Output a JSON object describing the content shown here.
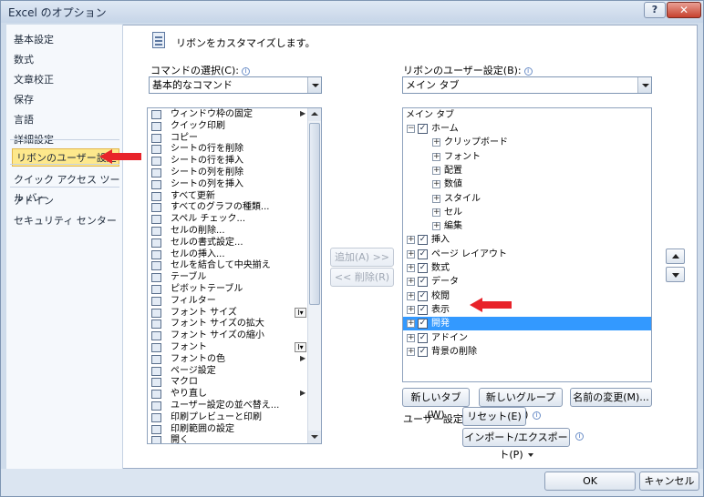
{
  "window": {
    "title": "Excel のオプション",
    "help_label": "?",
    "close_label": "✕"
  },
  "nav": {
    "items": [
      {
        "label": "基本設定"
      },
      {
        "label": "数式"
      },
      {
        "label": "文章校正"
      },
      {
        "label": "保存"
      },
      {
        "label": "言語"
      },
      {
        "label": "詳細設定"
      },
      {
        "label": "リボンのユーザー設定",
        "selected": true
      },
      {
        "label": "クイック アクセス ツール バー"
      },
      {
        "label": "アドイン"
      },
      {
        "label": "セキュリティ センター"
      }
    ]
  },
  "main": {
    "intro": "リボンをカスタマイズします。",
    "commands_label": "コマンドの選択(C):",
    "commands_value": "基本的なコマンド",
    "ribbon_label": "リボンのユーザー設定(B):",
    "ribbon_value": "メイン タブ",
    "commands": [
      {
        "label": "ウィンドウ枠の固定",
        "mark": "▶"
      },
      {
        "label": "クイック印刷"
      },
      {
        "label": "コピー"
      },
      {
        "label": "シートの行を削除"
      },
      {
        "label": "シートの行を挿入"
      },
      {
        "label": "シートの列を削除"
      },
      {
        "label": "シートの列を挿入"
      },
      {
        "label": "すべて更新"
      },
      {
        "label": "すべてのグラフの種類..."
      },
      {
        "label": "スペル チェック..."
      },
      {
        "label": "セルの削除..."
      },
      {
        "label": "セルの書式設定..."
      },
      {
        "label": "セルの挿入..."
      },
      {
        "label": "セルを結合して中央揃え"
      },
      {
        "label": "テーブル"
      },
      {
        "label": "ピボットテーブル"
      },
      {
        "label": "フィルター"
      },
      {
        "label": "フォント サイズ",
        "split": "I▾"
      },
      {
        "label": "フォント サイズの拡大"
      },
      {
        "label": "フォント サイズの縮小"
      },
      {
        "label": "フォント",
        "split": "I▾"
      },
      {
        "label": "フォントの色",
        "mark": "▶"
      },
      {
        "label": "ページ設定"
      },
      {
        "label": "マクロ"
      },
      {
        "label": "やり直し",
        "mark": "▶"
      },
      {
        "label": "ユーザー設定の並べ替え..."
      },
      {
        "label": "印刷プレビューと印刷"
      },
      {
        "label": "印刷範囲の設定"
      },
      {
        "label": "開く"
      }
    ],
    "add_button": "追加(A) >>",
    "remove_button": "<< 削除(R)",
    "tree": {
      "header": "メイン タブ",
      "rows": [
        {
          "label": "ホーム",
          "level": 0,
          "expander": "⊟",
          "checked": true
        },
        {
          "label": "クリップボード",
          "level": 1,
          "expander": "⊞"
        },
        {
          "label": "フォント",
          "level": 1,
          "expander": "⊞"
        },
        {
          "label": "配置",
          "level": 1,
          "expander": "⊞"
        },
        {
          "label": "数値",
          "level": 1,
          "expander": "⊞"
        },
        {
          "label": "スタイル",
          "level": 1,
          "expander": "⊞"
        },
        {
          "label": "セル",
          "level": 1,
          "expander": "⊞"
        },
        {
          "label": "編集",
          "level": 1,
          "expander": "⊞"
        },
        {
          "label": "挿入",
          "level": 0,
          "expander": "⊞",
          "checked": true
        },
        {
          "label": "ページ レイアウト",
          "level": 0,
          "expander": "⊞",
          "checked": true
        },
        {
          "label": "数式",
          "level": 0,
          "expander": "⊞",
          "checked": true
        },
        {
          "label": "データ",
          "level": 0,
          "expander": "⊞",
          "checked": true
        },
        {
          "label": "校閲",
          "level": 0,
          "expander": "⊞",
          "checked": true
        },
        {
          "label": "表示",
          "level": 0,
          "expander": "⊞",
          "checked": true
        },
        {
          "label": "開発",
          "level": 0,
          "expander": "⊞",
          "checked": true,
          "selected": true
        },
        {
          "label": "アドイン",
          "level": 0,
          "expander": "⊞",
          "checked": true
        },
        {
          "label": "背景の削除",
          "level": 0,
          "expander": "⊞",
          "checked": true
        }
      ]
    },
    "new_tab_button": "新しいタブ(W)",
    "new_group_button": "新しいグループ(N)",
    "rename_button": "名前の変更(M)...",
    "user_settings_label": "ユーザー設定:",
    "reset_button": "リセット(E)",
    "import_export_button": "インポート/エクスポート(P)"
  },
  "footer": {
    "ok_button": "OK",
    "cancel_button": "キャンセル"
  },
  "colors": {
    "annotation_arrow": "#e8232a",
    "selection": "#3399ff",
    "nav_selection": "#fde88c"
  }
}
